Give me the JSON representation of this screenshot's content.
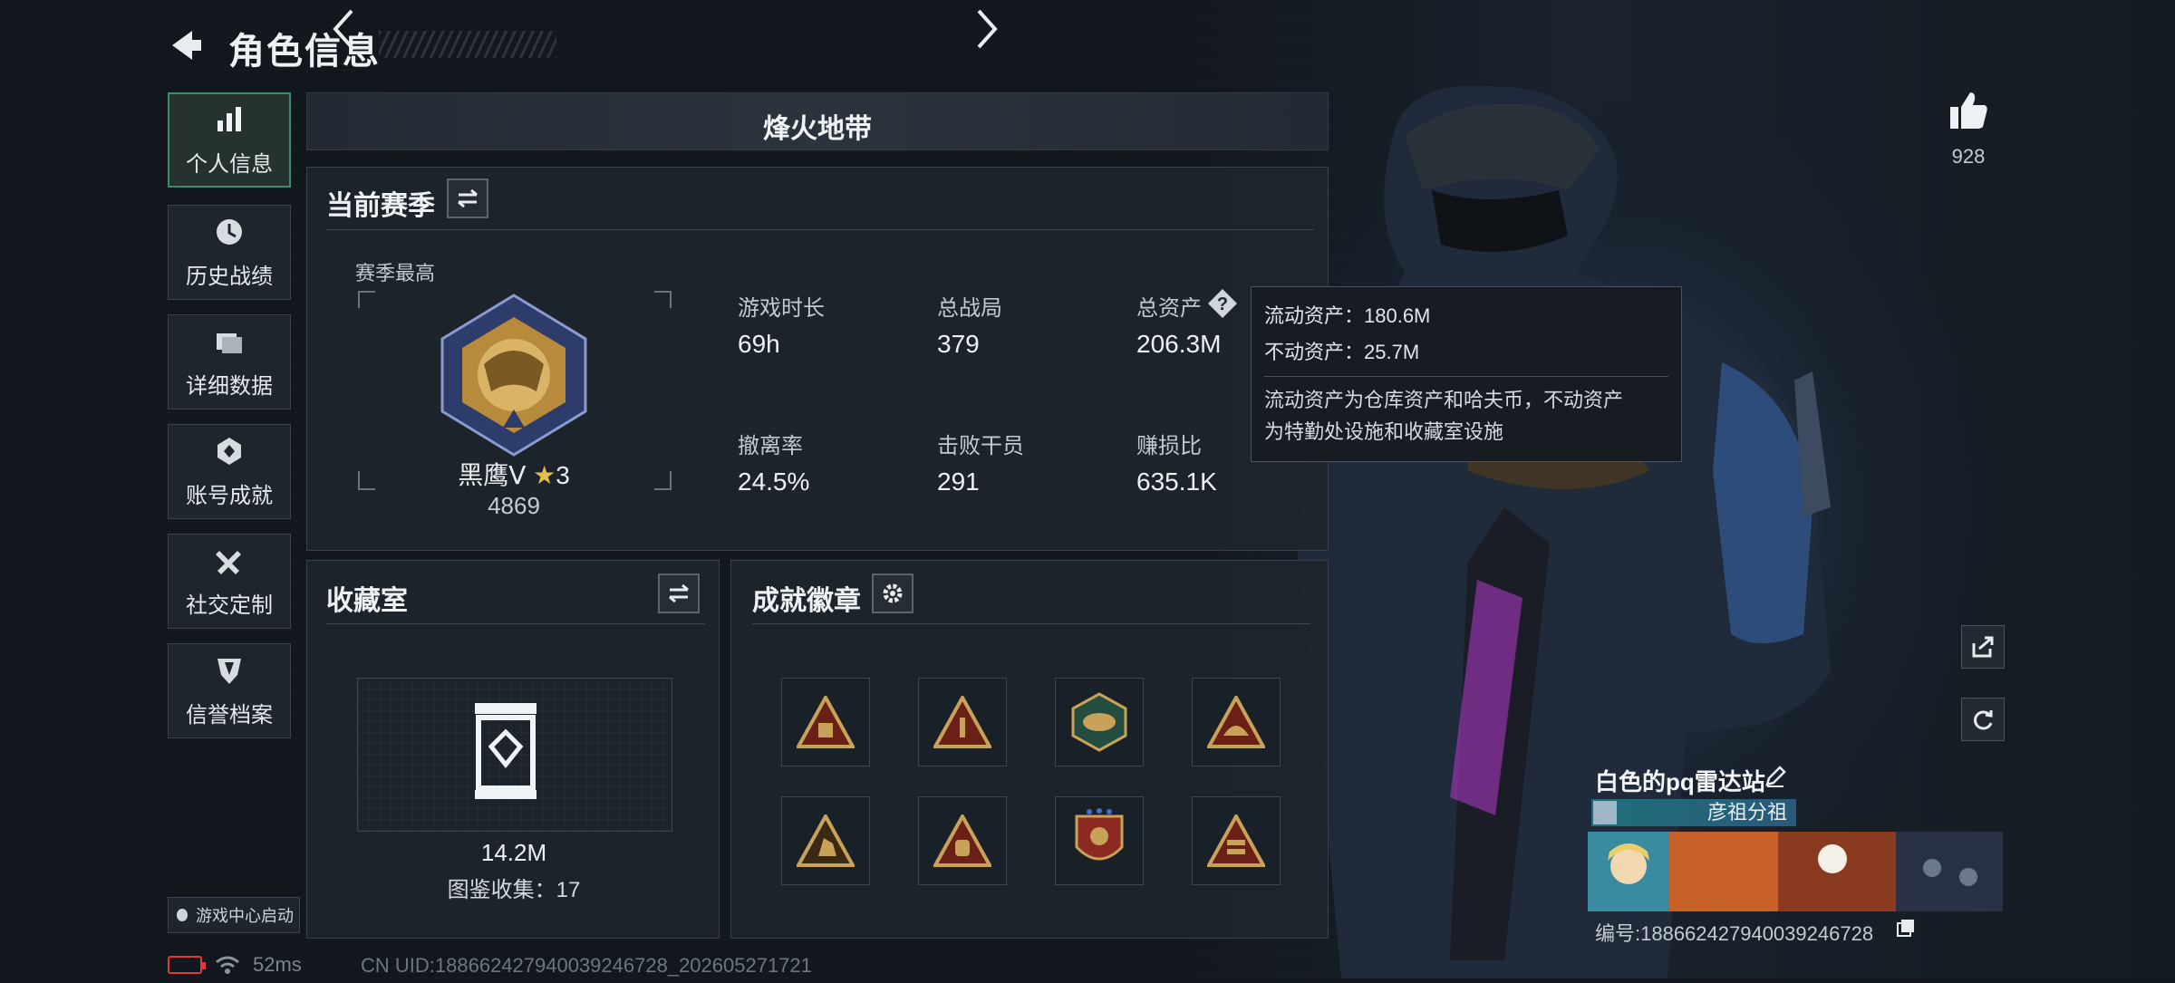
{
  "header": {
    "title": "角色信息"
  },
  "nav": {
    "items": [
      {
        "label": "个人信息",
        "icon": "bar-chart-icon",
        "active": true
      },
      {
        "label": "历史战绩",
        "icon": "clock-icon",
        "active": false
      },
      {
        "label": "详细数据",
        "icon": "folder-icon",
        "active": false
      },
      {
        "label": "账号成就",
        "icon": "achievement-icon",
        "active": false
      },
      {
        "label": "社交定制",
        "icon": "tools-icon",
        "active": false
      },
      {
        "label": "信誉档案",
        "icon": "shield-icon",
        "active": false
      }
    ],
    "game_center": "游戏中心启动"
  },
  "mode": {
    "name": "烽火地带"
  },
  "season": {
    "title": "当前赛季",
    "best_label": "赛季最高",
    "rank_name": "黑鹰Ⅴ",
    "rank_stars": "3",
    "rank_score": "4869",
    "stats": {
      "play_time_label": "游戏时长",
      "play_time": "69h",
      "matches_label": "总战局",
      "matches": "379",
      "assets_label": "总资产",
      "assets": "206.3M",
      "extract_label": "撤离率",
      "extract": "24.5%",
      "kills_label": "击败干员",
      "kills": "291",
      "profit_label": "赚损比",
      "profit": "635.1K"
    }
  },
  "tooltip": {
    "liquid": "流动资产：180.6M",
    "fixed": "不动资产：25.7M",
    "desc_1": "流动资产为仓库资产和哈夫币，不动资产",
    "desc_2": "为特勤处设施和收藏室设施"
  },
  "collection": {
    "title": "收藏室",
    "value": "14.2M",
    "count": "图鉴收集：17"
  },
  "badges": {
    "title": "成就徽章",
    "items": [
      "badge-1-icon",
      "badge-2-icon",
      "badge-3-icon",
      "badge-4-icon",
      "badge-5-icon",
      "badge-6-icon",
      "badge-7-icon",
      "badge-8-icon"
    ]
  },
  "profile": {
    "likes": "928",
    "player_name": "白色的pq雷达站",
    "clan": "彦祖分祖",
    "player_id": "编号:18866242794003924672​8"
  },
  "status": {
    "ping": "52ms",
    "uid": "CN UID:18866242794003924672​8_202605271721"
  },
  "colors": {
    "accent": "#3d8c6e",
    "badge_gold": "#c9a25a",
    "battery_low": "#e03b3b"
  }
}
